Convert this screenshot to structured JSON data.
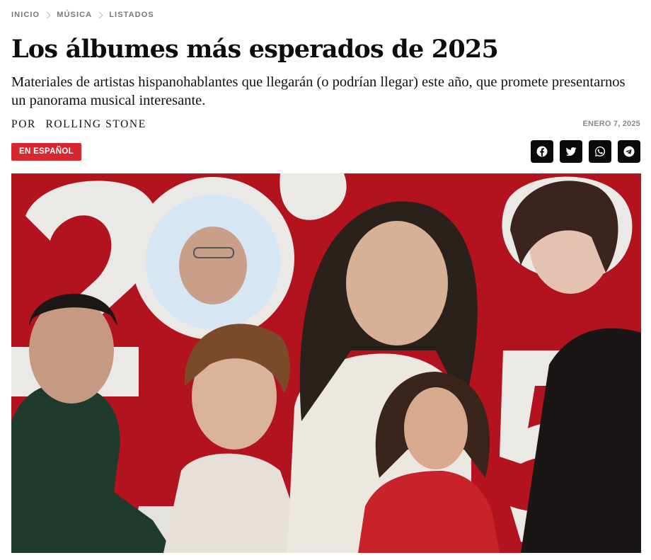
{
  "breadcrumb": {
    "items": [
      "INICIO",
      "MÚSICA",
      "LISTADOS"
    ]
  },
  "article": {
    "title": "Los álbumes más esperados de 2025",
    "subtitle": "Materiales de artistas hispanohablantes que llegarán (o podrían llegar) este año, que promete presentarnos un panorama musical interesante.",
    "byline_prefix": "POR",
    "author": "ROLLING STONE",
    "date": "ENERO 7, 2025",
    "tag": "EN ESPAÑOL"
  },
  "share": {
    "icons": [
      "facebook-icon",
      "twitter-icon",
      "whatsapp-icon",
      "telegram-icon"
    ]
  },
  "hero": {
    "background_color": "#b3131f",
    "tag_color": "#d7282f"
  }
}
